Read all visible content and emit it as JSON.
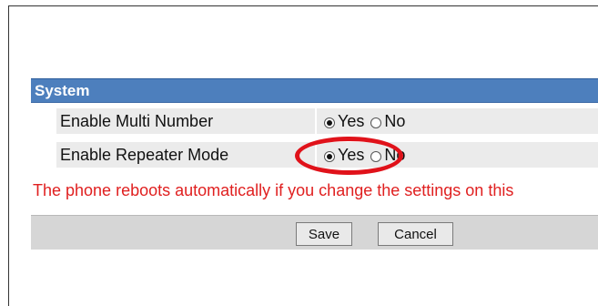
{
  "section": {
    "title": "System"
  },
  "rows": [
    {
      "label": "Enable Multi Number",
      "options": [
        {
          "label": "Yes",
          "checked": true
        },
        {
          "label": "No",
          "checked": false
        }
      ]
    },
    {
      "label": "Enable Repeater Mode",
      "options": [
        {
          "label": "Yes",
          "checked": true
        },
        {
          "label": "No",
          "checked": false
        }
      ]
    }
  ],
  "warning": "The phone reboots automatically if you change the settings on this",
  "buttons": {
    "save": "Save",
    "cancel": "Cancel"
  },
  "colors": {
    "header_bg": "#4d7fbd",
    "row_bg": "#ebebeb",
    "warning_text": "#e02020",
    "annotation": "#e0121a"
  }
}
